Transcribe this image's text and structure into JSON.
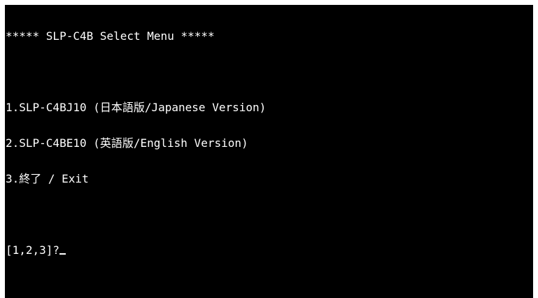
{
  "console": {
    "header": "***** SLP-C4B Select Menu *****",
    "menu": [
      {
        "label": "1.SLP-C4BJ10 (日本語版/Japanese Version)"
      },
      {
        "label": "2.SLP-C4BE10 (英語版/English Version)"
      },
      {
        "label": "3.終了 / Exit"
      }
    ],
    "prompt": "[1,2,3]?"
  },
  "colors": {
    "background": "#000000",
    "text": "#ffffff",
    "frame": "#ffffff"
  }
}
